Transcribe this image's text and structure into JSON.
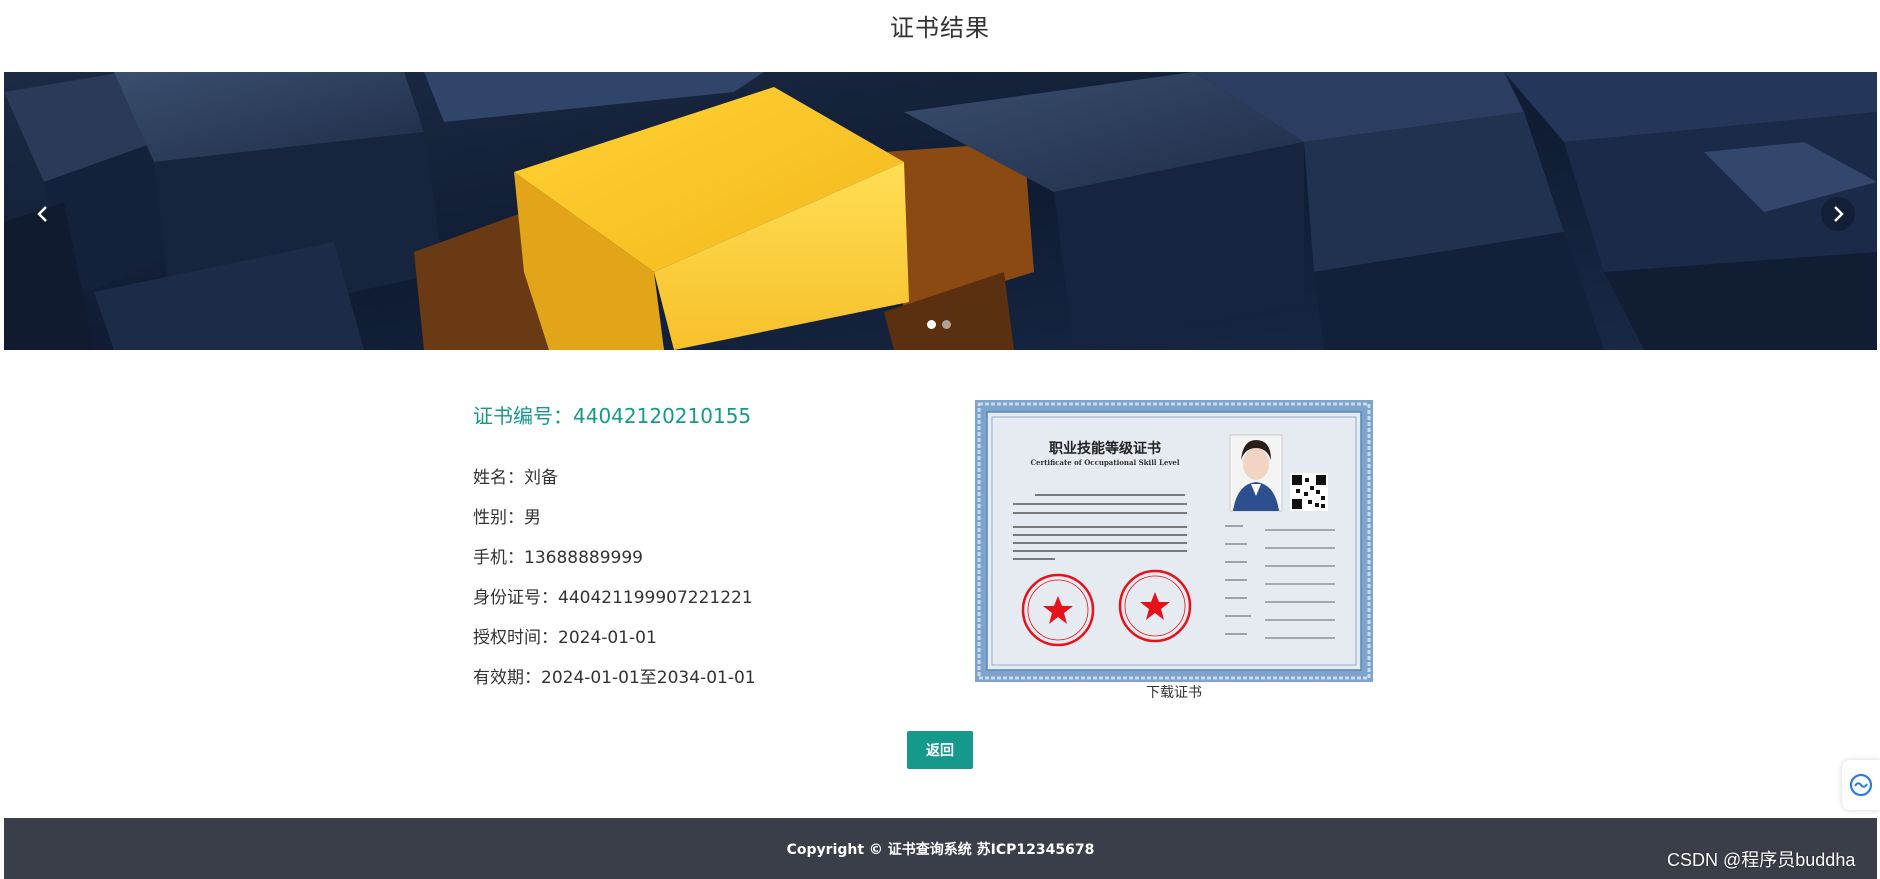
{
  "page": {
    "title": "证书结果"
  },
  "carousel": {
    "slide_count": 2,
    "active_index": 0
  },
  "certificate": {
    "number_label": "证书编号：",
    "number": "44042120210155",
    "fields": [
      {
        "label": "姓名：",
        "value": "刘备"
      },
      {
        "label": "性别：",
        "value": "男"
      },
      {
        "label": "手机：",
        "value": "13688889999"
      },
      {
        "label": "身份证号：",
        "value": "440421199907221221"
      },
      {
        "label": "授权时间：",
        "value": "2024-01-01"
      },
      {
        "label": "有效期：",
        "value": "2024-01-01至2034-01-01"
      }
    ],
    "image": {
      "title_cn": "职业技能等级证书",
      "title_en": "Certificate of Occupational Skill Level"
    },
    "download_label": "下载证书"
  },
  "actions": {
    "back_label": "返回"
  },
  "footer": {
    "copyright": "Copyright © 证书查询系统 苏ICP12345678"
  },
  "watermark": {
    "text": "CSDN @程序员buddha"
  },
  "colors": {
    "accent": "#14998b",
    "footer_bg": "#3a3e48",
    "banner_cube": "#f5c02a"
  }
}
